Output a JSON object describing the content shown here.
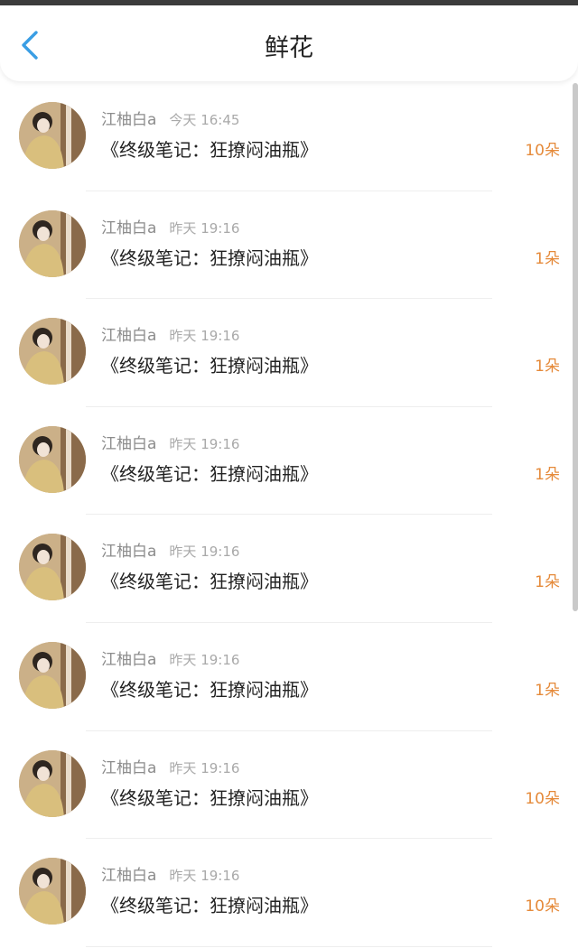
{
  "header": {
    "title": "鲜花",
    "back_icon": "chevron-left-icon"
  },
  "colors": {
    "accent_blue": "#3a9ee4",
    "count_orange": "#e58a3a",
    "text_primary": "#222222",
    "text_secondary": "#8c8c8c"
  },
  "list": {
    "items": [
      {
        "user": "江柚白a",
        "time": "今天 16:45",
        "book": "《终级笔记：狂撩闷油瓶》",
        "count": "10朵"
      },
      {
        "user": "江柚白a",
        "time": "昨天 19:16",
        "book": "《终级笔记：狂撩闷油瓶》",
        "count": "1朵"
      },
      {
        "user": "江柚白a",
        "time": "昨天 19:16",
        "book": "《终级笔记：狂撩闷油瓶》",
        "count": "1朵"
      },
      {
        "user": "江柚白a",
        "time": "昨天 19:16",
        "book": "《终级笔记：狂撩闷油瓶》",
        "count": "1朵"
      },
      {
        "user": "江柚白a",
        "time": "昨天 19:16",
        "book": "《终级笔记：狂撩闷油瓶》",
        "count": "1朵"
      },
      {
        "user": "江柚白a",
        "time": "昨天 19:16",
        "book": "《终级笔记：狂撩闷油瓶》",
        "count": "1朵"
      },
      {
        "user": "江柚白a",
        "time": "昨天 19:16",
        "book": "《终级笔记：狂撩闷油瓶》",
        "count": "10朵"
      },
      {
        "user": "江柚白a",
        "time": "昨天 19:16",
        "book": "《终级笔记：狂撩闷油瓶》",
        "count": "10朵"
      }
    ]
  }
}
